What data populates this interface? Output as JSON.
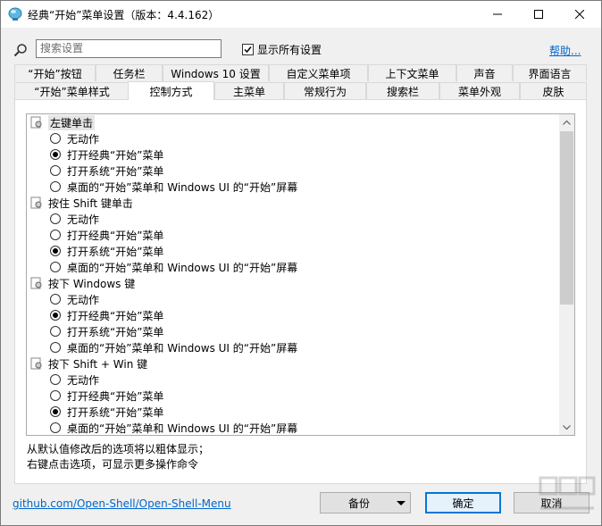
{
  "window": {
    "title": "经典“开始”菜单设置（版本：4.4.162）"
  },
  "search": {
    "placeholder": "搜索设置",
    "show_all_label": "显示所有设置",
    "show_all_checked": true,
    "help_label": "帮助..."
  },
  "tabs_row1": [
    {
      "label": "“开始”按钮"
    },
    {
      "label": "任务栏"
    },
    {
      "label": "Windows 10 设置"
    },
    {
      "label": "自定义菜单项"
    },
    {
      "label": "上下文菜单"
    },
    {
      "label": "声音"
    },
    {
      "label": "界面语言"
    }
  ],
  "tabs_row2": [
    {
      "label": "“开始”菜单样式"
    },
    {
      "label": "控制方式",
      "active": true
    },
    {
      "label": "主菜单"
    },
    {
      "label": "常规行为"
    },
    {
      "label": "搜索栏"
    },
    {
      "label": "菜单外观"
    },
    {
      "label": "皮肤"
    }
  ],
  "groups": [
    {
      "label": "左键单击",
      "options": [
        {
          "label": "无动作",
          "selected": false
        },
        {
          "label": "打开经典“开始”菜单",
          "selected": true
        },
        {
          "label": "打开系统“开始”菜单",
          "selected": false
        },
        {
          "label": "桌面的“开始”菜单和 Windows UI 的“开始”屏幕",
          "selected": false
        }
      ]
    },
    {
      "label": "按住 Shift 键单击",
      "options": [
        {
          "label": "无动作",
          "selected": false
        },
        {
          "label": "打开经典“开始”菜单",
          "selected": false
        },
        {
          "label": "打开系统“开始”菜单",
          "selected": true
        },
        {
          "label": "桌面的“开始”菜单和 Windows UI 的“开始”屏幕",
          "selected": false
        }
      ]
    },
    {
      "label": "按下 Windows 键",
      "options": [
        {
          "label": "无动作",
          "selected": false
        },
        {
          "label": "打开经典“开始”菜单",
          "selected": true
        },
        {
          "label": "打开系统“开始”菜单",
          "selected": false
        },
        {
          "label": "桌面的“开始”菜单和 Windows UI 的“开始”屏幕",
          "selected": false
        }
      ]
    },
    {
      "label": "按下 Shift + Win 键",
      "options": [
        {
          "label": "无动作",
          "selected": false
        },
        {
          "label": "打开经典“开始”菜单",
          "selected": false
        },
        {
          "label": "打开系统“开始”菜单",
          "selected": true
        },
        {
          "label": "桌面的“开始”菜单和 Windows UI 的“开始”屏幕",
          "selected": false
        }
      ]
    }
  ],
  "description": {
    "line1": "从默认值修改后的选项将以粗体显示；",
    "line2": "右键点击选项，可显示更多操作命令"
  },
  "footer": {
    "link": "github.com/Open-Shell/Open-Shell-Menu",
    "backup_label": "备份",
    "ok_label": "确定",
    "cancel_label": "取消"
  },
  "colors": {
    "accent": "#0078d7",
    "link": "#0066cc"
  }
}
